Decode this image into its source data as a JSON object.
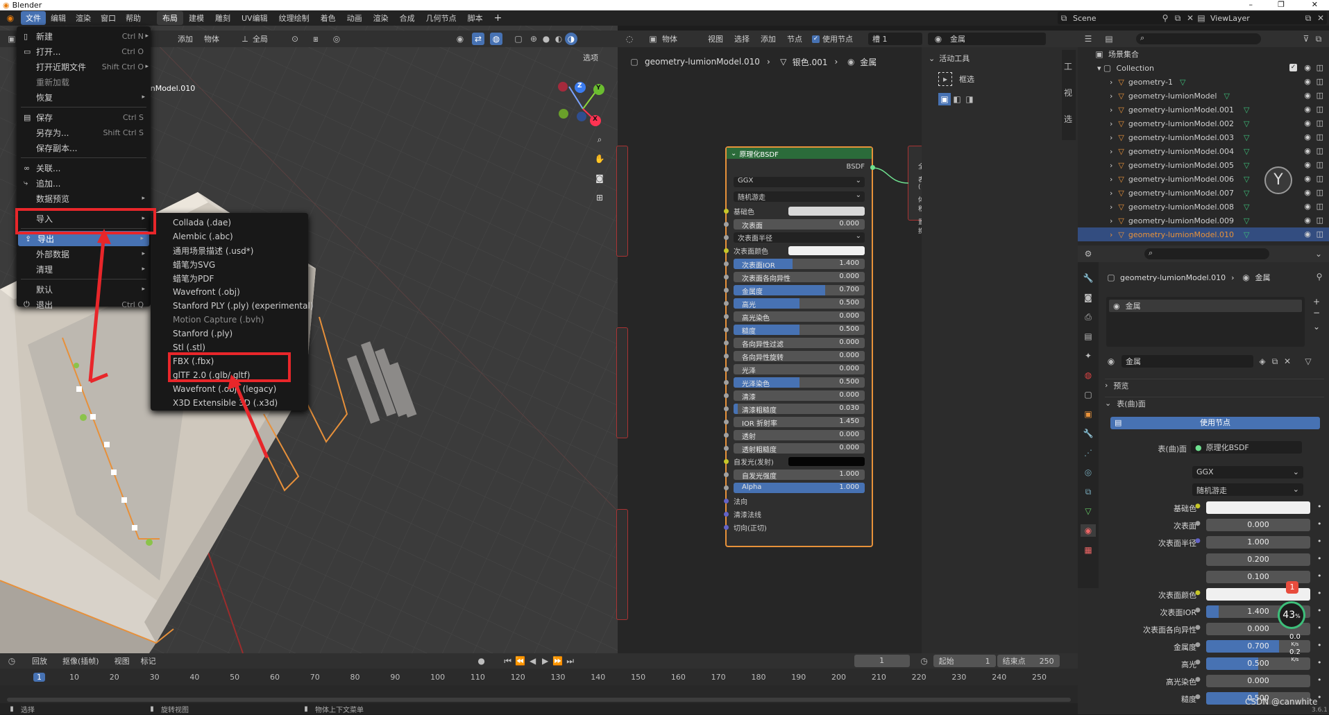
{
  "titlebar": {
    "app_title": "Blender",
    "min": "–",
    "max": "❐",
    "close": "✕"
  },
  "topbar": {
    "menus": [
      "文件",
      "编辑",
      "渲染",
      "窗口",
      "帮助"
    ],
    "workspaces": [
      "布局",
      "建模",
      "雕刻",
      "UV编辑",
      "纹理绘制",
      "着色",
      "动画",
      "渲染",
      "合成",
      "几何节点",
      "脚本"
    ],
    "add_tab": "+",
    "scene_label": "Scene",
    "viewlayer_label": "ViewLayer"
  },
  "viewport": {
    "header_items": [
      "添加",
      "物体"
    ],
    "transform_label": "全局",
    "options_label": "选项",
    "object_label": "onModel.010",
    "axis_x": "X",
    "axis_y": "Y",
    "axis_z": "Z"
  },
  "file_menu": {
    "items": [
      {
        "label": "新建",
        "shortcut": "Ctrl N",
        "icon": "doc-icon",
        "arrow": "▸"
      },
      {
        "label": "打开...",
        "shortcut": "Ctrl O",
        "icon": "folder-icon"
      },
      {
        "label": "打开近期文件",
        "shortcut": "Shift Ctrl O",
        "arrow": "▸"
      },
      {
        "label": "重新加载",
        "disabled": true
      },
      {
        "label": "恢复",
        "arrow": "▸"
      },
      {
        "label": "保存",
        "shortcut": "Ctrl S",
        "icon": "save-icon"
      },
      {
        "label": "另存为...",
        "shortcut": "Shift Ctrl S"
      },
      {
        "label": "保存副本..."
      },
      {
        "label": "关联...",
        "icon": "link-icon"
      },
      {
        "label": "追加...",
        "icon": "append-icon"
      },
      {
        "label": "数据预览",
        "arrow": "▸"
      },
      {
        "label": "导入",
        "arrow": "▸"
      },
      {
        "label": "导出",
        "arrow": "▸",
        "active": true,
        "icon": "export-icon"
      },
      {
        "label": "外部数据",
        "arrow": "▸"
      },
      {
        "label": "清理",
        "arrow": "▸"
      },
      {
        "label": "默认",
        "arrow": "▸"
      },
      {
        "label": "退出",
        "shortcut": "Ctrl Q",
        "icon": "power-icon"
      }
    ]
  },
  "export_menu": {
    "items": [
      {
        "label": "Collada (.dae)"
      },
      {
        "label": "Alembic (.abc)"
      },
      {
        "label": "通用场景描述 (.usd*)"
      },
      {
        "label": "蜡笔为SVG"
      },
      {
        "label": "蜡笔为PDF"
      },
      {
        "label": "Wavefront (.obj)"
      },
      {
        "label": "Stanford PLY (.ply) (experimental)"
      },
      {
        "label": "Motion Capture (.bvh)",
        "disabled": true
      },
      {
        "label": "Stanford (.ply)"
      },
      {
        "label": "Stl (.stl)"
      },
      {
        "label": "FBX (.fbx)",
        "highlight": true
      },
      {
        "label": "glTF 2.0 (.glb/.gltf)",
        "highlight": true
      },
      {
        "label": "Wavefront (.obj) (legacy)"
      },
      {
        "label": "X3D Extensible 3D (.x3d)"
      }
    ]
  },
  "node_editor": {
    "header": [
      "物体",
      "视图",
      "选择",
      "添加",
      "节点"
    ],
    "use_nodes": "使用节点",
    "slot": "槽 1",
    "material": "金属",
    "breadcrumb": [
      "geometry-lumionModel.010",
      "银色.001",
      "金属"
    ],
    "node_title": "原理化BSDF",
    "node_output": "BSDF",
    "dist": "GGX",
    "sss_method": "随机游走",
    "rows": [
      {
        "label": "基础色",
        "type": "color",
        "color": "#d9d9d9"
      },
      {
        "label": "次表面",
        "value": "0.000",
        "frac": 0
      },
      {
        "label": "次表面半径",
        "type": "dropdown"
      },
      {
        "label": "次表面颜色",
        "type": "color",
        "color": "#f2f2f2"
      },
      {
        "label": "次表面IOR",
        "value": "1.400",
        "frac": 0.45
      },
      {
        "label": "次表面各向异性",
        "value": "0.000",
        "frac": 0
      },
      {
        "label": "金属度",
        "value": "0.700",
        "frac": 0.7
      },
      {
        "label": "高光",
        "value": "0.500",
        "frac": 0.5
      },
      {
        "label": "高光染色",
        "value": "0.000",
        "frac": 0
      },
      {
        "label": "糙度",
        "value": "0.500",
        "frac": 0.5
      },
      {
        "label": "各向异性过滤",
        "value": "0.000",
        "frac": 0
      },
      {
        "label": "各向异性旋转",
        "value": "0.000",
        "frac": 0
      },
      {
        "label": "光泽",
        "value": "0.000",
        "frac": 0
      },
      {
        "label": "光泽染色",
        "value": "0.500",
        "frac": 0.5
      },
      {
        "label": "清漆",
        "value": "0.000",
        "frac": 0
      },
      {
        "label": "清漆粗糙度",
        "value": "0.030",
        "frac": 0.03
      },
      {
        "label": "IOR 折射率",
        "value": "1.450",
        "frac": 0
      },
      {
        "label": "透射",
        "value": "0.000",
        "frac": 0
      },
      {
        "label": "透射粗糙度",
        "value": "0.000",
        "frac": 0
      },
      {
        "label": "自发光(发射)",
        "type": "color",
        "color": "#050505"
      },
      {
        "label": "自发光强度",
        "value": "1.000",
        "frac": 0
      },
      {
        "label": "Alpha",
        "value": "1.000",
        "frac": 1
      },
      {
        "label": "法向",
        "type": "socket"
      },
      {
        "label": "清漆法线",
        "type": "socket"
      },
      {
        "label": "切向(正切)",
        "type": "socket"
      }
    ],
    "side_node_labels": [
      "全",
      "表(",
      "体积",
      "置换"
    ]
  },
  "tool_panel": {
    "title": "活动工具",
    "tool": "框选"
  },
  "outliner": {
    "root": "场景集合",
    "collection": "Collection",
    "items": [
      "geometry-1",
      "geometry-lumionModel",
      "geometry-lumionModel.001",
      "geometry-lumionModel.002",
      "geometry-lumionModel.003",
      "geometry-lumionModel.004",
      "geometry-lumionModel.005",
      "geometry-lumionModel.006",
      "geometry-lumionModel.007",
      "geometry-lumionModel.008",
      "geometry-lumionModel.009",
      "geometry-lumionModel.010"
    ],
    "selected_index": 11
  },
  "properties": {
    "breadcrumb_obj": "geometry-lumionModel.010",
    "breadcrumb_mat": "金属",
    "slot_name": "金属",
    "mat_field": "金属",
    "preview": "预览",
    "surface_header": "表(曲)面",
    "use_nodes": "使用节点",
    "surface_label": "表(曲)面",
    "surface_value": "原理化BSDF",
    "dist": "GGX",
    "sss_method": "随机游走",
    "rows": [
      {
        "label": "基础色",
        "type": "color"
      },
      {
        "label": "次表面",
        "value": "0.000",
        "frac": 0
      },
      {
        "label": "次表面半径",
        "value": "1.000",
        "frac": 0
      },
      {
        "label": "",
        "value": "0.200",
        "frac": 0
      },
      {
        "label": "",
        "value": "0.100",
        "frac": 0
      },
      {
        "label": "次表面颜色",
        "type": "color"
      },
      {
        "label": "次表面IOR",
        "value": "1.400",
        "frac": 0.12
      },
      {
        "label": "次表面各向异性",
        "value": "0.000",
        "frac": 0
      },
      {
        "label": "金属度",
        "value": "0.700",
        "frac": 0.7
      },
      {
        "label": "高光",
        "value": "0.500",
        "frac": 0.5
      },
      {
        "label": "高光染色",
        "value": "0.000",
        "frac": 0
      },
      {
        "label": "糙度",
        "value": "0.500",
        "frac": 0.5
      }
    ],
    "badge": "1",
    "perf_pct": "43",
    "perf_unit": "%",
    "net_up": "0.0",
    "net_down": "0.2",
    "net_unit": "K/s",
    "watermark": "CSDN @canwhite",
    "version": "3.6.1"
  },
  "timeline": {
    "playback": "回放",
    "keying": "抠像(插帧)",
    "view": "视图",
    "marker": "标记",
    "current_frame": "1",
    "start_label": "起始",
    "start": "1",
    "end_label": "结束点",
    "end": "250",
    "ticks": [
      "1",
      "10",
      "20",
      "30",
      "40",
      "50",
      "60",
      "70",
      "80",
      "90",
      "100",
      "110",
      "120",
      "130",
      "140",
      "150",
      "160",
      "170",
      "180",
      "190",
      "200",
      "210",
      "220",
      "230",
      "240",
      "250"
    ]
  },
  "statusbar": {
    "select": "选择",
    "rotate": "旋转视图",
    "context": "物体上下文菜单"
  },
  "colors": {
    "accent": "#4772b3",
    "highlight_red": "#e8262a",
    "node_header": "#2b6b3a",
    "selected_row": "#334d80"
  }
}
